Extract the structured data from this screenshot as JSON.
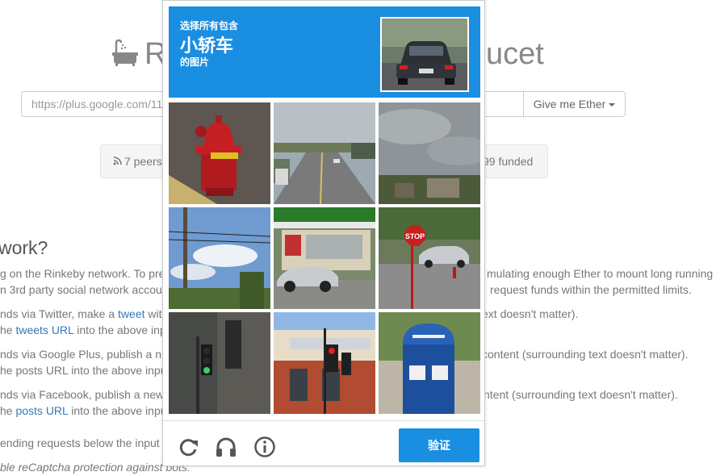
{
  "page": {
    "title_left": "R",
    "title_right": "ucet",
    "url_input_value": "https://plus.google.com/11",
    "give_button_label": "Give me Ether",
    "peers_text": "7 peers",
    "funded_text": "99 funded",
    "section_title": "work?",
    "paragraphs": [
      {
        "left": "g on the Rinkeby network. To prev",
        "right": "mulating enough Ether to mount long running s"
      },
      {
        "left": "n 3rd party social network accou",
        "right": "request funds within the permitted limits."
      },
      {
        "left_a": "nds via Twitter, make a ",
        "link": "tweet",
        "left_b": " wit",
        "right": "ext doesn't matter)."
      },
      {
        "left_a": "he ",
        "link": "tweets URL",
        "left_b": " into the above inpu"
      },
      {
        "left": "nds via Google Plus, publish a n",
        "right": "content (surrounding text doesn't matter)."
      },
      {
        "left": "he posts URL into the above inpu"
      },
      {
        "left": "nds via Facebook, publish a new",
        "right": "ntent (surrounding text doesn't matter)."
      },
      {
        "left_a": "he ",
        "link": "posts URL",
        "left_b": " into the above inpu"
      },
      {
        "left": "ending requests below the input f"
      },
      {
        "left": "ble reCaptcha protection against bots."
      }
    ]
  },
  "captcha": {
    "instruction_line1": "选择所有包含",
    "instruction_target": "小轿车",
    "instruction_line3": "的图片",
    "verify_label": "验证",
    "icons": [
      "reload-icon",
      "audio-icon",
      "info-icon"
    ],
    "tiles": [
      "fire-hydrant",
      "road-with-truck",
      "cloudy-sky",
      "power-lines-sky",
      "gas-station-with-car",
      "stop-sign-with-car",
      "traffic-light-building",
      "bank-with-traffic-light",
      "blue-mailbox"
    ],
    "colors": {
      "accent": "#1a8ee1",
      "link": "#337ab7"
    }
  }
}
